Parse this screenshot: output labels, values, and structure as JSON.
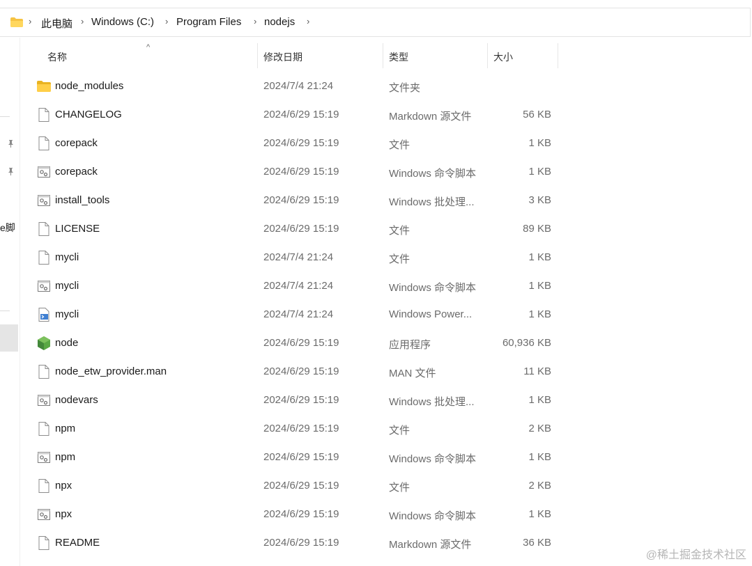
{
  "breadcrumb": [
    "此电脑",
    "Windows (C:)",
    "Program Files",
    "nodejs"
  ],
  "left_pane_text": "e脚",
  "columns": {
    "name": "名称",
    "date": "修改日期",
    "type": "类型",
    "size": "大小"
  },
  "files": [
    {
      "name": "node_modules",
      "date": "2024/7/4 21:24",
      "type": "文件夹",
      "size": "",
      "icon": "folder-icon"
    },
    {
      "name": "CHANGELOG",
      "date": "2024/6/29 15:19",
      "type": "Markdown 源文件",
      "size": "56 KB",
      "icon": "file-icon"
    },
    {
      "name": "corepack",
      "date": "2024/6/29 15:19",
      "type": "文件",
      "size": "1 KB",
      "icon": "file-icon"
    },
    {
      "name": "corepack",
      "date": "2024/6/29 15:19",
      "type": "Windows 命令脚本",
      "size": "1 KB",
      "icon": "script-icon"
    },
    {
      "name": "install_tools",
      "date": "2024/6/29 15:19",
      "type": "Windows 批处理...",
      "size": "3 KB",
      "icon": "script-icon"
    },
    {
      "name": "LICENSE",
      "date": "2024/6/29 15:19",
      "type": "文件",
      "size": "89 KB",
      "icon": "file-icon"
    },
    {
      "name": "mycli",
      "date": "2024/7/4 21:24",
      "type": "文件",
      "size": "1 KB",
      "icon": "file-icon"
    },
    {
      "name": "mycli",
      "date": "2024/7/4 21:24",
      "type": "Windows 命令脚本",
      "size": "1 KB",
      "icon": "script-icon"
    },
    {
      "name": "mycli",
      "date": "2024/7/4 21:24",
      "type": "Windows Power...",
      "size": "1 KB",
      "icon": "powershell-icon"
    },
    {
      "name": "node",
      "date": "2024/6/29 15:19",
      "type": "应用程序",
      "size": "60,936 KB",
      "icon": "node-app-icon"
    },
    {
      "name": "node_etw_provider.man",
      "date": "2024/6/29 15:19",
      "type": "MAN 文件",
      "size": "11 KB",
      "icon": "file-icon"
    },
    {
      "name": "nodevars",
      "date": "2024/6/29 15:19",
      "type": "Windows 批处理...",
      "size": "1 KB",
      "icon": "script-icon"
    },
    {
      "name": "npm",
      "date": "2024/6/29 15:19",
      "type": "文件",
      "size": "2 KB",
      "icon": "file-icon"
    },
    {
      "name": "npm",
      "date": "2024/6/29 15:19",
      "type": "Windows 命令脚本",
      "size": "1 KB",
      "icon": "script-icon"
    },
    {
      "name": "npx",
      "date": "2024/6/29 15:19",
      "type": "文件",
      "size": "2 KB",
      "icon": "file-icon"
    },
    {
      "name": "npx",
      "date": "2024/6/29 15:19",
      "type": "Windows 命令脚本",
      "size": "1 KB",
      "icon": "script-icon"
    },
    {
      "name": "README",
      "date": "2024/6/29 15:19",
      "type": "Markdown 源文件",
      "size": "36 KB",
      "icon": "file-icon"
    }
  ],
  "watermark": "@稀土掘金技术社区"
}
